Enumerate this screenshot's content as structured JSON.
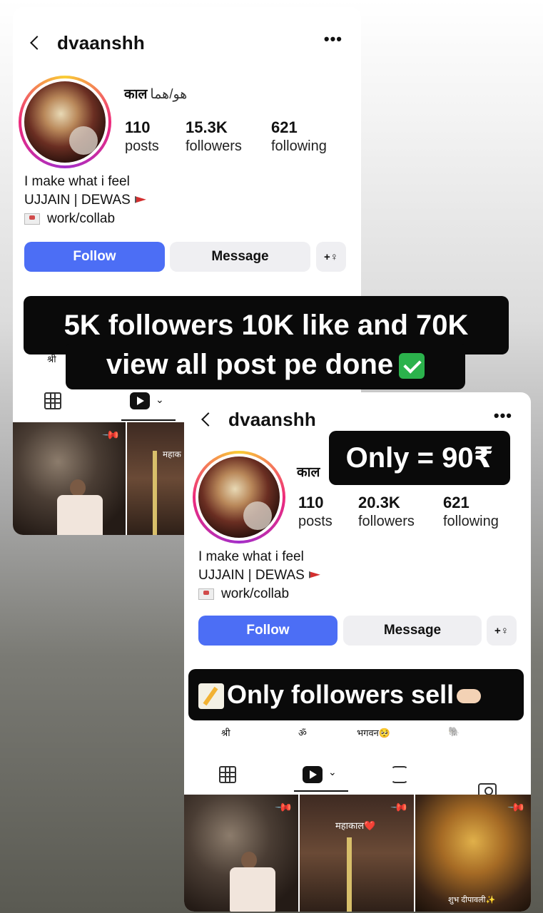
{
  "card1": {
    "username": "dvaanshh",
    "display_name": "काल",
    "display_name_extra": "هو/هما",
    "stats": [
      {
        "value": "110",
        "label": "posts"
      },
      {
        "value": "15.3K",
        "label": "followers"
      },
      {
        "value": "621",
        "label": "following"
      }
    ],
    "bio": [
      "I make what i feel",
      "UJJAIN | DEWAS",
      "work/collab"
    ],
    "buttons": {
      "follow": "Follow",
      "message": "Message",
      "add": "+♀"
    },
    "highlight_first": "श्री"
  },
  "card2": {
    "username": "dvaanshh",
    "display_name": "काल",
    "stats": [
      {
        "value": "110",
        "label": "posts"
      },
      {
        "value": "20.3K",
        "label": "followers"
      },
      {
        "value": "621",
        "label": "following"
      }
    ],
    "bio": [
      "I make what i feel",
      "UJJAIN | DEWAS",
      "work/collab"
    ],
    "buttons": {
      "follow": "Follow",
      "message": "Message",
      "add": "+♀"
    },
    "highlights": [
      "श्री",
      "ॐ",
      "भगवन🥺",
      "🐘"
    ],
    "thumb_texts": [
      "महाकाल❤️",
      "शुभ दीपावली✨"
    ]
  },
  "card1_thumb_text": "महाक",
  "overlays": {
    "line1": "5K followers 10K like and 70K",
    "line2": "view all post pe done",
    "price": "Only = 90₹",
    "sell": "Only followers sell"
  },
  "colors": {
    "follow_button": "#4c6ef5",
    "overlay_bg": "#0a0a0a"
  },
  "icons": [
    "back-icon",
    "more-icon",
    "grid-icon",
    "reels-icon",
    "repost-icon",
    "tagged-icon",
    "pin-icon",
    "mail-icon",
    "flag-icon",
    "check-icon",
    "pencil-icon",
    "pointing-hand-icon"
  ]
}
